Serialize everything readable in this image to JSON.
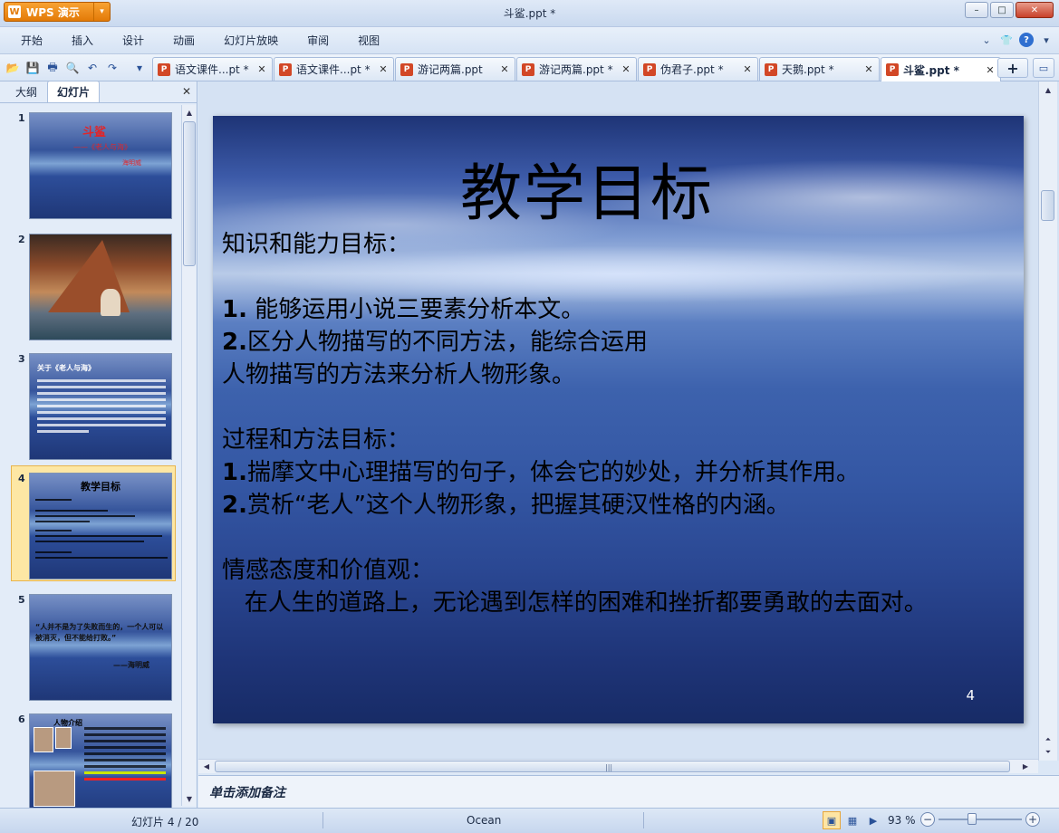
{
  "window": {
    "app_name": "WPS 演示",
    "title": "斗鲨.ppt *",
    "minimize": "–",
    "maximize": "□",
    "close": "✕"
  },
  "menu": {
    "items": [
      "开始",
      "插入",
      "设计",
      "动画",
      "幻灯片放映",
      "审阅",
      "视图"
    ]
  },
  "tabs": [
    {
      "label": "语文课件...pt *",
      "active": false
    },
    {
      "label": "语文课件...pt *",
      "active": false
    },
    {
      "label": "游记两篇.ppt",
      "active": false
    },
    {
      "label": "游记两篇.ppt *",
      "active": false
    },
    {
      "label": "伪君子.ppt *",
      "active": false
    },
    {
      "label": "天鹅.ppt *",
      "active": false
    },
    {
      "label": "斗鲨.ppt *",
      "active": true
    }
  ],
  "left_pane": {
    "tab_outline": "大纲",
    "tab_slides": "幻灯片",
    "thumbnails": [
      {
        "num": "1",
        "title": "斗鲨",
        "subtitle": "——《老人与海》",
        "author": "海明威"
      },
      {
        "num": "2"
      },
      {
        "num": "3",
        "heading": "关于《老人与海》"
      },
      {
        "num": "4",
        "title": "教学目标"
      },
      {
        "num": "5",
        "quote": "“人并不是为了失败而生的，一个人可以被消灭，但不能给打败。”",
        "author": "——海明威"
      },
      {
        "num": "6",
        "title": "人物介绍"
      }
    ]
  },
  "slide": {
    "title": "教学目标",
    "page_number": "4",
    "lines": [
      {
        "bold": "",
        "text": "知识和能力目标："
      },
      {
        "bold": "",
        "text": ""
      },
      {
        "bold": "1.",
        "text": " 能够运用小说三要素分析本文。"
      },
      {
        "bold": "2.",
        "text": "区分人物描写的不同方法，能综合运用"
      },
      {
        "bold": "",
        "text": "人物描写的方法来分析人物形象。"
      },
      {
        "bold": "",
        "text": ""
      },
      {
        "bold": "",
        "text": "过程和方法目标："
      },
      {
        "bold": "1.",
        "text": "揣摩文中心理描写的句子，体会它的妙处，并分析其作用。"
      },
      {
        "bold": "2.",
        "text": "赏析“老人”这个人物形象，把握其硬汉性格的内涵。"
      },
      {
        "bold": "",
        "text": ""
      },
      {
        "bold": "",
        "text": "情感态度和价值观："
      },
      {
        "bold": "",
        "text": "   在人生的道路上，无论遇到怎样的困难和挫折都要勇敢的去面对。"
      }
    ]
  },
  "notes": {
    "placeholder": "单击添加备注"
  },
  "status": {
    "slide_counter": "幻灯片 4 / 20",
    "theme": "Ocean",
    "zoom": "93 %",
    "zoom_fraction": 0.4
  }
}
